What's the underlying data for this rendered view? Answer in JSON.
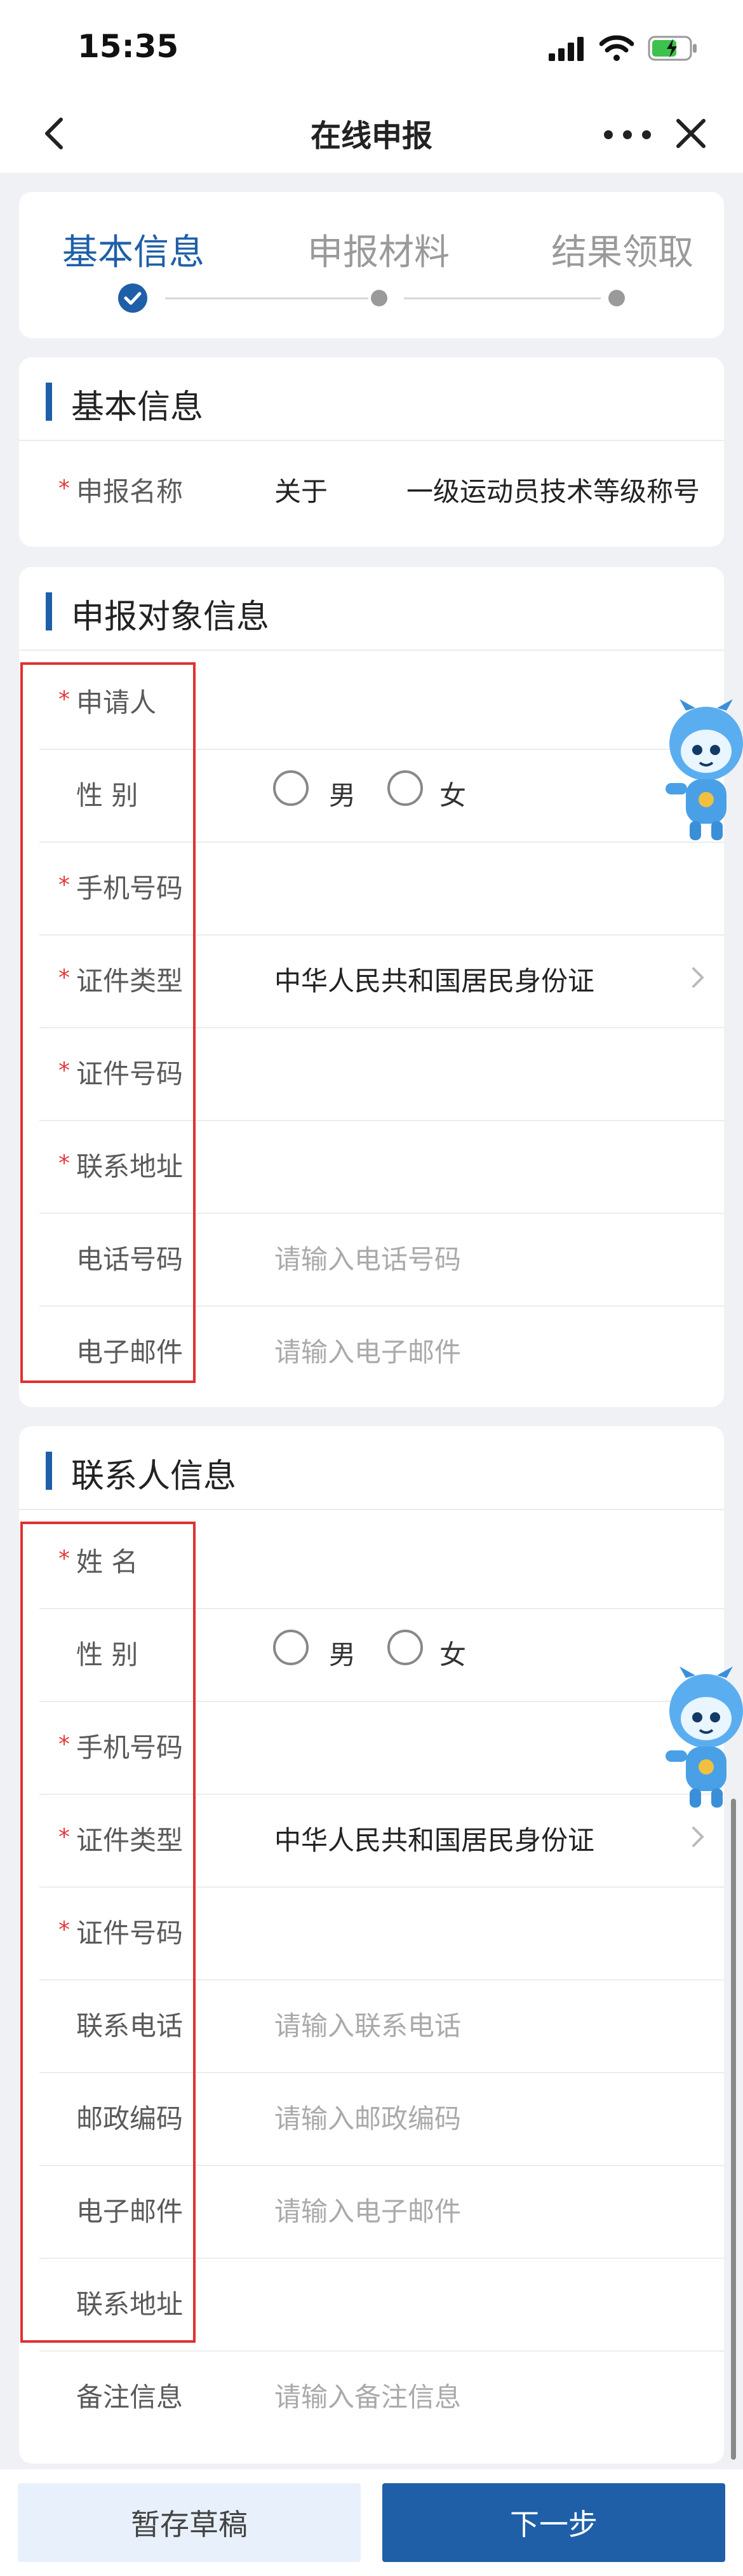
{
  "status_bar": {
    "time": "15:35"
  },
  "nav": {
    "title": "在线申报",
    "back_icon": "back-arrow-icon",
    "more_icon": "more-dots-icon",
    "close_icon": "close-icon"
  },
  "steps": [
    {
      "label": "基本信息",
      "state": "done"
    },
    {
      "label": "申报材料",
      "state": "pending"
    },
    {
      "label": "结果领取",
      "state": "pending"
    }
  ],
  "basic_info": {
    "title": "基本信息",
    "declare_name_label": "申报名称",
    "declare_name_value_a": "关于",
    "declare_name_value_b": "一级运动员技术等级称号"
  },
  "applicant": {
    "title": "申报对象信息",
    "fields": {
      "applicant": "申请人",
      "gender": "性  别",
      "mobile": "手机号码",
      "id_type": "证件类型",
      "id_number": "证件号码",
      "address": "联系地址",
      "phone": "电话号码",
      "email": "电子邮件"
    },
    "gender_options": [
      "男",
      "女"
    ],
    "id_type_value": "中华人民共和国居民身份证",
    "phone_placeholder": "请输入电话号码",
    "email_placeholder": "请输入电子邮件"
  },
  "contact": {
    "title": "联系人信息",
    "fields": {
      "name": "姓  名",
      "gender": "性  别",
      "mobile": "手机号码",
      "id_type": "证件类型",
      "id_number": "证件号码",
      "tel": "联系电话",
      "postcode": "邮政编码",
      "email": "电子邮件",
      "address": "联系地址",
      "remark": "备注信息"
    },
    "gender_options": [
      "男",
      "女"
    ],
    "id_type_value": "中华人民共和国居民身份证",
    "tel_placeholder": "请输入联系电话",
    "postcode_placeholder": "请输入邮政编码",
    "email_placeholder": "请输入电子邮件",
    "remark_placeholder": "请输入备注信息"
  },
  "buttons": {
    "draft": "暂存草稿",
    "next": "下一步"
  },
  "colors": {
    "accent": "#1f5fa8",
    "required": "#e23c3c",
    "highlight_box": "#e03030"
  }
}
